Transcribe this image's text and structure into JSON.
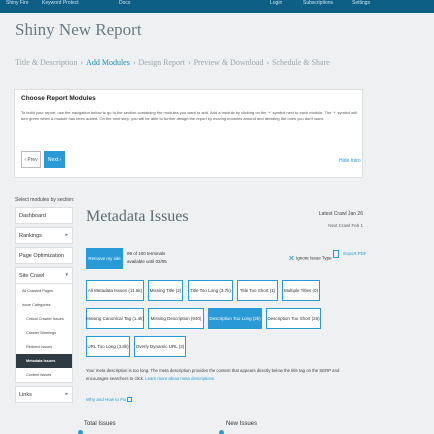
{
  "topbar": {
    "left_items": [
      "Shiny Fire",
      "Keyword Protect",
      "Docs"
    ],
    "right_items": [
      "Login",
      "Subscriptions",
      "Settings"
    ]
  },
  "page_title": "Shiny New Report",
  "steps": [
    {
      "label": "Title & Description",
      "active": false
    },
    {
      "label": "Add Modules",
      "active": true
    },
    {
      "label": "Design Report",
      "active": false
    },
    {
      "label": "Preview & Download",
      "active": false
    },
    {
      "label": "Schedule & Share",
      "active": false
    }
  ],
  "steps_sep": "›",
  "choose": {
    "title": "Choose Report Modules",
    "text": "To build your report, use the navigation below to go to the section containing the modules you want to add. Add a module by clicking on the '+' symbol next to each module. The '+' symbol will turn green when a module has been added. On the next step, you will be able to further design the report by moving modules around and deciding the ones you don't want.",
    "prev": "‹ Prev",
    "next": "Next ›",
    "hide": "Hide Intro"
  },
  "sidebar_title": "Select modules by section:",
  "sidebar": {
    "dashboard": "Dashboard",
    "rankings": "Rankings",
    "page_opt": "Page Optimization",
    "site_crawl": "Site Crawl",
    "all_crawled": "All Crawled Pages",
    "issue_categories": "Issue Categories",
    "critical": "Critical Crawler Issues",
    "crawler_warnings": "Crawler Warnings",
    "redirect": "Redirect Issues",
    "metadata": "Metadata Issues",
    "content": "Content Issues",
    "links": "Links"
  },
  "main": {
    "title": "Metadata Issues",
    "crawl_date": "Latest Crawl Jan 26",
    "next_crawl": "Next Crawl Feb 1",
    "filter_btn": "Remove my site",
    "row_count_line1": "99 of 100 terminals",
    "row_count_line2": "available until 02/05",
    "ignore_label": "Ignore Issue Type",
    "export_label": "Export PDF"
  },
  "chips": [
    {
      "label": "All Metadata Issues (11.5k)",
      "active": false
    },
    {
      "label": "Missing Title (2)",
      "active": false
    },
    {
      "label": "Title Too Long (3.7k)",
      "active": false
    },
    {
      "label": "Title Too Short (1)",
      "active": false
    },
    {
      "label": "Multiple Titles (0)",
      "active": false
    },
    {
      "label": "Missing Canonical Tag (1.4k)",
      "active": false
    },
    {
      "label": "Missing Description (940)",
      "active": false
    },
    {
      "label": "Description Too Long (2k)",
      "active": true
    },
    {
      "label": "Description Too Short (26)",
      "active": false
    },
    {
      "label": "URL Too Long (3.8k)",
      "active": false
    },
    {
      "label": "Overly Dynamic URL (3)",
      "active": false
    }
  ],
  "description": {
    "text": "Your meta description is too long. The meta description provides the content that appears directly below the title tag on the SERP and encourages searchers to click.",
    "learn_more": "Learn more about meta descriptions."
  },
  "why": "Why and How to Fix",
  "bottom": {
    "total": "Total Issues",
    "new": "New Issues"
  },
  "colors": {
    "accent": "#2a9ad6",
    "topbar": "#0e5f86",
    "active_nav": "#2f3b43"
  }
}
